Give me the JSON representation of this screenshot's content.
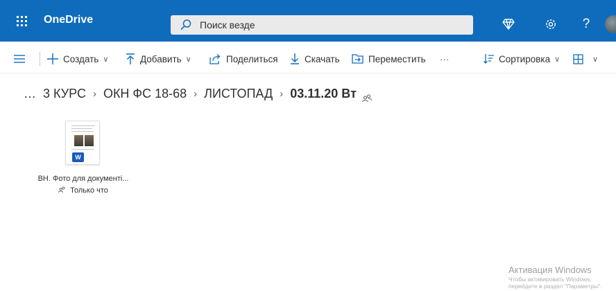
{
  "header": {
    "app_icon": "waffle-icon",
    "brand": "OneDrive",
    "search_text": "Поиск везде",
    "icons": [
      "diamond-icon",
      "gear-icon",
      "help-icon"
    ],
    "help_glyph": "?",
    "colors": {
      "header_bg": "#0f6cbd",
      "accent": "#0f6cbd"
    }
  },
  "commands": {
    "create": "Создать",
    "upload": "Добавить",
    "share": "Поделиться",
    "download": "Скачать",
    "move": "Переместить",
    "more": "···",
    "sort": "Сортировка"
  },
  "breadcrumb": {
    "ellipsis": "…",
    "items": [
      "3 КУРС",
      "ОКН ФС 18-68",
      "ЛИСТОПАД"
    ],
    "current": "03.11.20 Вт",
    "separator": "›"
  },
  "files": [
    {
      "name": "ВН. Фото для документі...",
      "modified": "Только что",
      "type_badge": "W",
      "type_icon": "word-icon"
    }
  ],
  "watermark": {
    "title": "Активация Windows",
    "subtitle": "Чтобы активировать Windows, перейдите в раздел \"Параметры\"."
  }
}
